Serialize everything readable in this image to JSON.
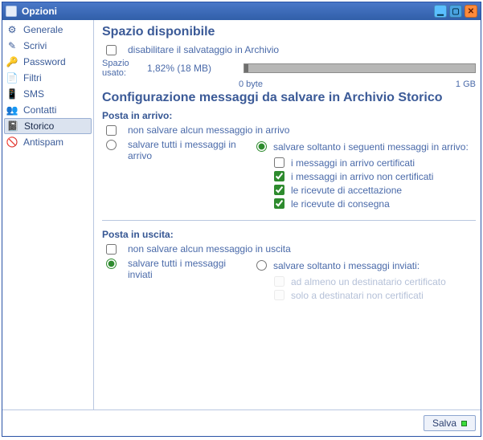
{
  "window": {
    "title": "Opzioni"
  },
  "sidebar": {
    "items": [
      {
        "label": "Generale",
        "icon": "⚙"
      },
      {
        "label": "Scrivi",
        "icon": "✎"
      },
      {
        "label": "Password",
        "icon": "🔑"
      },
      {
        "label": "Filtri",
        "icon": "📄"
      },
      {
        "label": "SMS",
        "icon": "📱"
      },
      {
        "label": "Contatti",
        "icon": "👥"
      },
      {
        "label": "Storico",
        "icon": "📓"
      },
      {
        "label": "Antispam",
        "icon": "🚫"
      }
    ],
    "selected_index": 6
  },
  "section_space": {
    "heading": "Spazio disponibile",
    "disable_save_label": "disabilitare il salvataggio in Archivio",
    "disable_save_checked": false,
    "usage_caption": "Spazio usato:",
    "usage_text": "1,82% (18 MB)",
    "usage_fraction": 0.018,
    "scale_min": "0 byte",
    "scale_max": "1 GB"
  },
  "section_config": {
    "heading": "Configurazione messaggi da salvare in Archivio Storico",
    "inbox": {
      "title": "Posta in arrivo:",
      "none_label": "non salvare alcun messaggio in arrivo",
      "none_checked": false,
      "all_label": "salvare tutti i messaggi in arrivo",
      "all_selected": false,
      "some_label": "salvare soltanto i seguenti messaggi in arrivo:",
      "some_selected": true,
      "sub": [
        {
          "label": "i messaggi in arrivo certificati",
          "checked": false
        },
        {
          "label": "i messaggi in arrivo non certificati",
          "checked": true
        },
        {
          "label": "le ricevute di accettazione",
          "checked": true
        },
        {
          "label": "le ricevute di consegna",
          "checked": true
        }
      ]
    },
    "outbox": {
      "title": "Posta in uscita:",
      "none_label": "non salvare alcun messaggio in uscita",
      "none_checked": false,
      "all_label": "salvare tutti i messaggi inviati",
      "all_selected": true,
      "some_label": "salvare soltanto i messaggi inviati:",
      "some_selected": false,
      "sub": [
        {
          "label": "ad almeno un destinatario certificato",
          "checked": false,
          "disabled": true
        },
        {
          "label": "solo a destinatari non certificati",
          "checked": false,
          "disabled": true
        }
      ]
    }
  },
  "footer": {
    "save_label": "Salva"
  }
}
